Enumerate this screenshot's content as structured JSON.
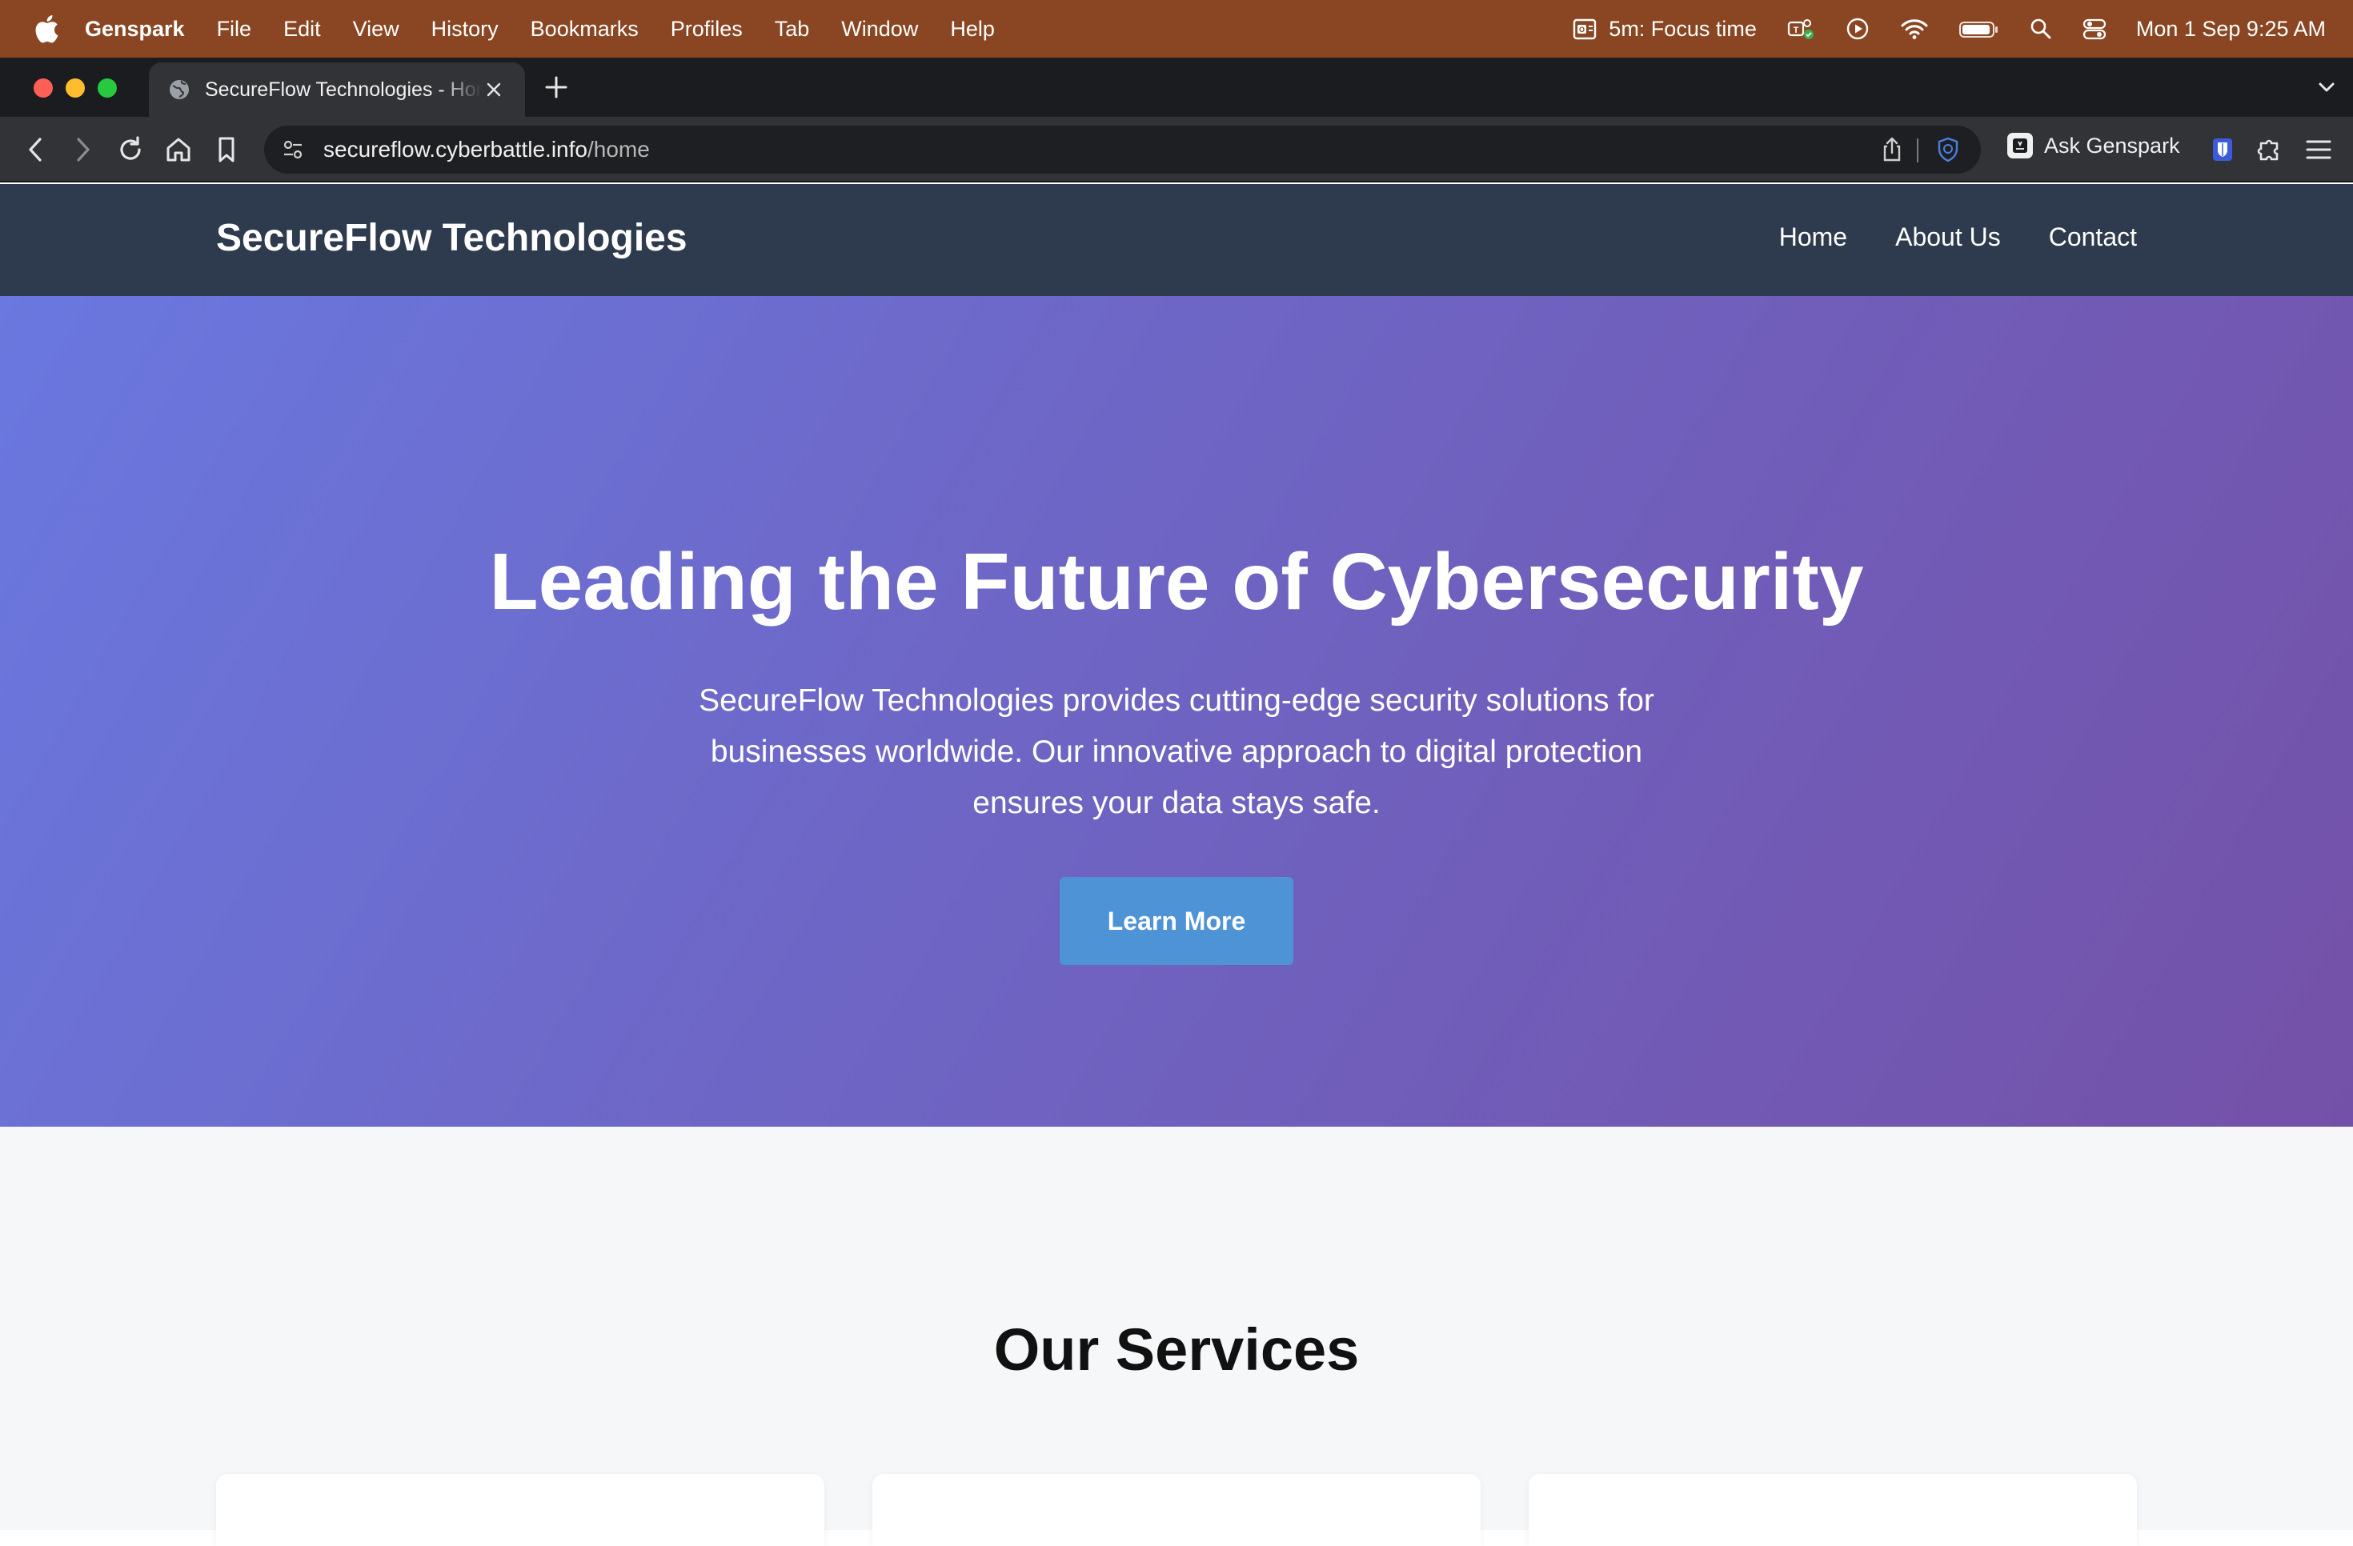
{
  "menubar": {
    "app_name": "Genspark",
    "items": [
      "File",
      "Edit",
      "View",
      "History",
      "Bookmarks",
      "Profiles",
      "Tab",
      "Window",
      "Help"
    ],
    "focus_text": "5m:  Focus time",
    "datetime": "Mon 1 Sep  9:25 AM"
  },
  "browser": {
    "tab_title": "SecureFlow Technologies - Home",
    "url_host": "secureflow.cyberbattle.info",
    "url_path": "/home",
    "ask_label": "Ask Genspark"
  },
  "site": {
    "brand": "SecureFlow Technologies",
    "nav": [
      "Home",
      "About Us",
      "Contact"
    ],
    "hero": {
      "title": "Leading the Future of Cybersecurity",
      "description": "SecureFlow Technologies provides cutting-edge security solutions for businesses worldwide. Our innovative approach to digital protection ensures your data stays safe.",
      "cta": "Learn More"
    },
    "services_title": "Our Services"
  },
  "colors": {
    "menubar": "#8a4622",
    "site_nav": "#2e3a4d",
    "hero_gradient_start": "#6a78df",
    "hero_gradient_end": "#7451a8",
    "cta": "#4e93d6"
  }
}
